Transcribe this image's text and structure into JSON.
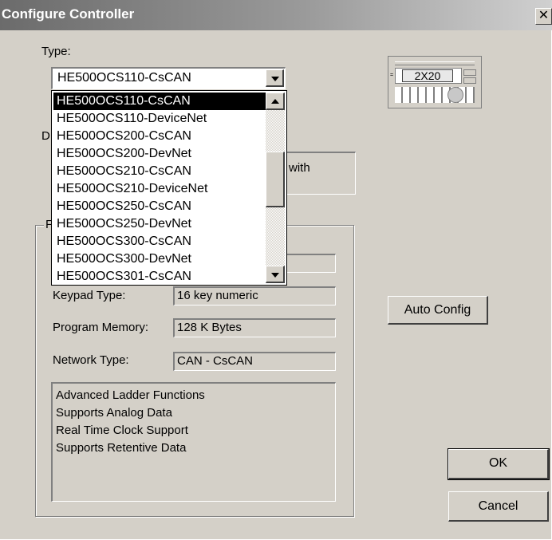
{
  "window": {
    "title": "Configure Controller",
    "close_glyph": "✕"
  },
  "type_label": "Type:",
  "combo": {
    "value": "HE500OCS110-CsCAN"
  },
  "dropdown": {
    "items": [
      "HE500OCS110-CsCAN",
      "HE500OCS110-DeviceNet",
      "HE500OCS200-CsCAN",
      "HE500OCS200-DevNet",
      "HE500OCS210-CsCAN",
      "HE500OCS210-DeviceNet",
      "HE500OCS250-CsCAN",
      "HE500OCS250-DevNet",
      "HE500OCS300-CsCAN",
      "HE500OCS300-DevNet",
      "HE500OCS301-CsCAN"
    ],
    "selected_index": 0
  },
  "obscured": {
    "desc_label_fragment": "D",
    "desc_text_fragment": "with",
    "group_label_fragment": "F"
  },
  "device_image": {
    "display": "2X20"
  },
  "fields": {
    "keypad": {
      "label": "Keypad Type:",
      "value": "16 key numeric"
    },
    "memory": {
      "label": "Program Memory:",
      "value": "128 K Bytes"
    },
    "network": {
      "label": "Network Type:",
      "value": "CAN - CsCAN"
    }
  },
  "features": [
    "Advanced Ladder Functions",
    "Supports Analog Data",
    "Real Time Clock Support",
    "Supports Retentive Data"
  ],
  "buttons": {
    "auto_config": "Auto Config",
    "ok": "OK",
    "cancel": "Cancel"
  }
}
